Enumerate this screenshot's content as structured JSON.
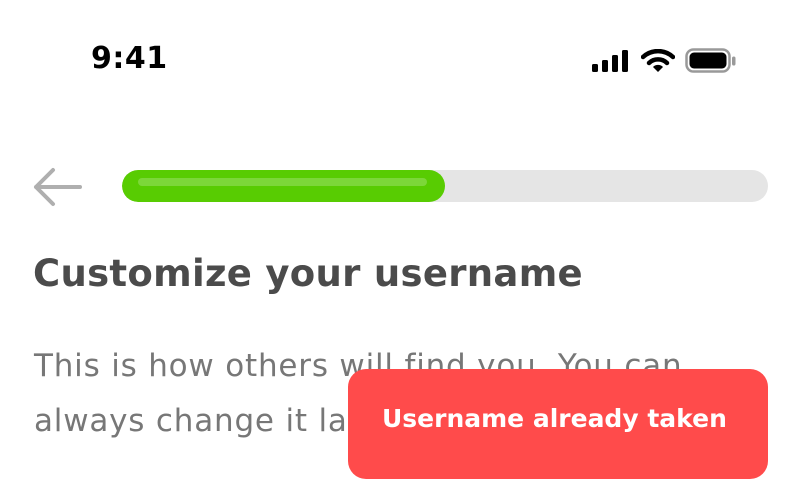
{
  "status_bar": {
    "time": "9:41",
    "icons": [
      "cellular-signal-icon",
      "wifi-icon",
      "battery-icon"
    ]
  },
  "nav": {
    "back_icon": "arrow-left-icon",
    "progress": 0.5
  },
  "page": {
    "title": "Customize your username",
    "description_lines": [
      "This is how others will find you. You can",
      "always change it later."
    ]
  },
  "toast": {
    "message": "Username already taken"
  },
  "colors": {
    "progress_fill": "#58cc02",
    "progress_track": "#e5e5e5",
    "error": "#ff4b4b",
    "title_text": "#4b4b4b",
    "body_text": "#777777"
  }
}
